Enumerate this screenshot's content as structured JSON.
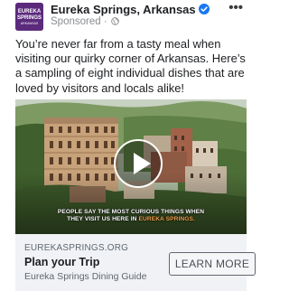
{
  "post": {
    "avatar_text_line1": "EUREKA",
    "avatar_text_line2": "SPRINGS",
    "avatar_text_line3": "ARKANSAS",
    "page_name": "Eureka Springs, Arkansas",
    "sponsored": "Sponsored",
    "separator": "·",
    "more_icon": "•••",
    "body": "You’re never far from a tasty meal when visiting our quirky corner of Arkansas. Here’s a sampling of eight individual dishes that are loved by visitors and locals alike!"
  },
  "media": {
    "caption_part1": "PEOPLE SAY THE MOST CURIOUS THINGS WHEN",
    "caption_part2": "THEY VISIT US HERE IN",
    "caption_highlight": "EUREKA SPRINGS."
  },
  "cta": {
    "domain": "EUREKASPRINGS.ORG",
    "title": "Plan your Trip",
    "description": "Eureka Springs Dining Guide",
    "button_label": "LEARN MORE"
  },
  "colors": {
    "avatar_bg": "#5b2a7c",
    "verified_blue": "#1877f2",
    "caption_highlight": "#f2a24c",
    "cta_bg": "#f0f2f5"
  },
  "icons": [
    "verified-badge-icon",
    "globe-icon",
    "more-options-icon",
    "play-icon"
  ]
}
